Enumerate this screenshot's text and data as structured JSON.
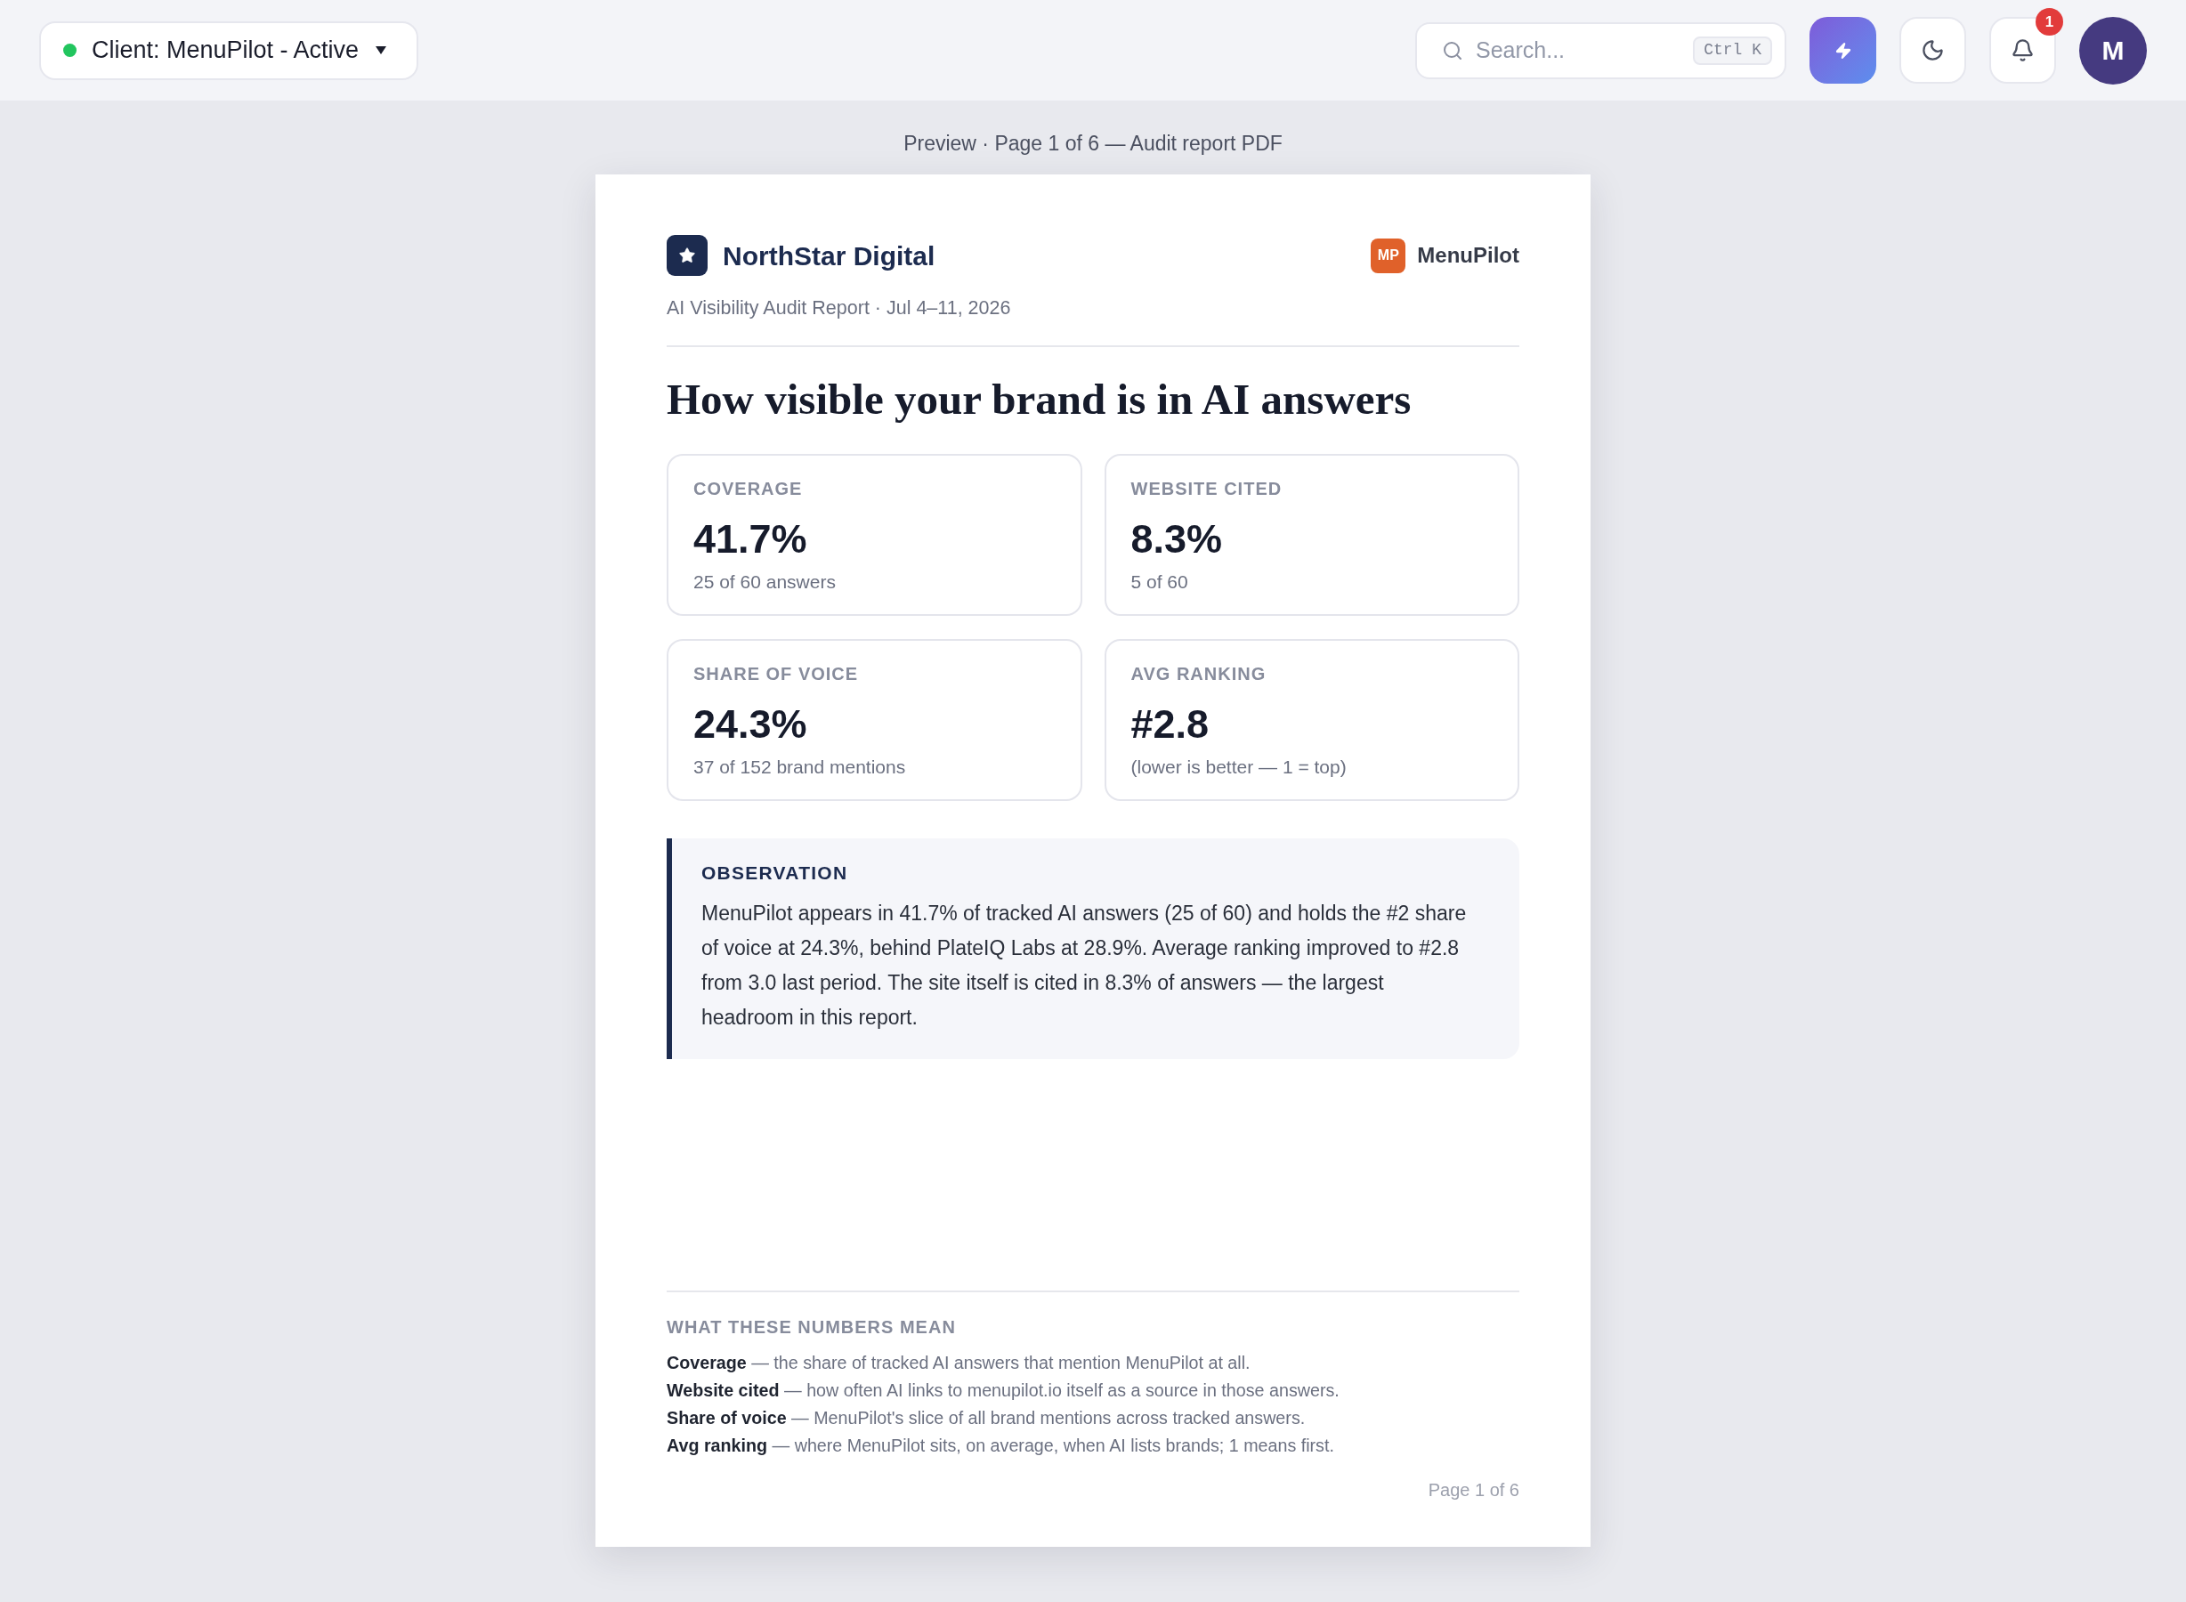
{
  "top_bar": {
    "client_selector": {
      "label": "Client: MenuPilot - Active"
    },
    "search": {
      "placeholder": "Search...",
      "shortcut": "Ctrl K"
    },
    "notifications": {
      "count": "1"
    },
    "avatar": {
      "initial": "M"
    }
  },
  "preview_caption": "Preview · Page 1 of 6 — Audit report PDF",
  "report": {
    "agency": {
      "name": "NorthStar Digital"
    },
    "client": {
      "logo_text": "MP",
      "name": "MenuPilot"
    },
    "subtitle": "AI Visibility Audit Report · Jul 4–11, 2026",
    "heading": "How visible your brand is in AI answers",
    "metrics": [
      {
        "label": "COVERAGE",
        "value": "41.7%",
        "detail": "25 of 60 answers"
      },
      {
        "label": "WEBSITE CITED",
        "value": "8.3%",
        "detail": "5 of 60"
      },
      {
        "label": "SHARE OF VOICE",
        "value": "24.3%",
        "detail": "37 of 152 brand mentions"
      },
      {
        "label": "AVG RANKING",
        "value": "#2.8",
        "detail": "(lower is better — 1 = top)"
      }
    ],
    "observation": {
      "title": "OBSERVATION",
      "text": "MenuPilot appears in 41.7% of tracked AI answers (25 of 60) and holds the #2 share of voice at 24.3%, behind PlateIQ Labs at 28.9%. Average ranking improved to #2.8 from 3.0 last period. The site itself is cited in 8.3% of answers — the largest headroom in this report."
    },
    "glossary": {
      "title": "WHAT THESE NUMBERS MEAN",
      "items": [
        "**Coverage** — the share of tracked AI answers that mention MenuPilot at all.",
        "**Website cited** — how often AI links to menupilot.io itself as a source in those answers.",
        "**Share of voice** — MenuPilot's slice of all brand mentions across tracked answers.",
        "**Avg ranking** — where MenuPilot sits, on average, when AI lists brands; 1 means first."
      ]
    },
    "page_number": "Page 1 of 6"
  }
}
